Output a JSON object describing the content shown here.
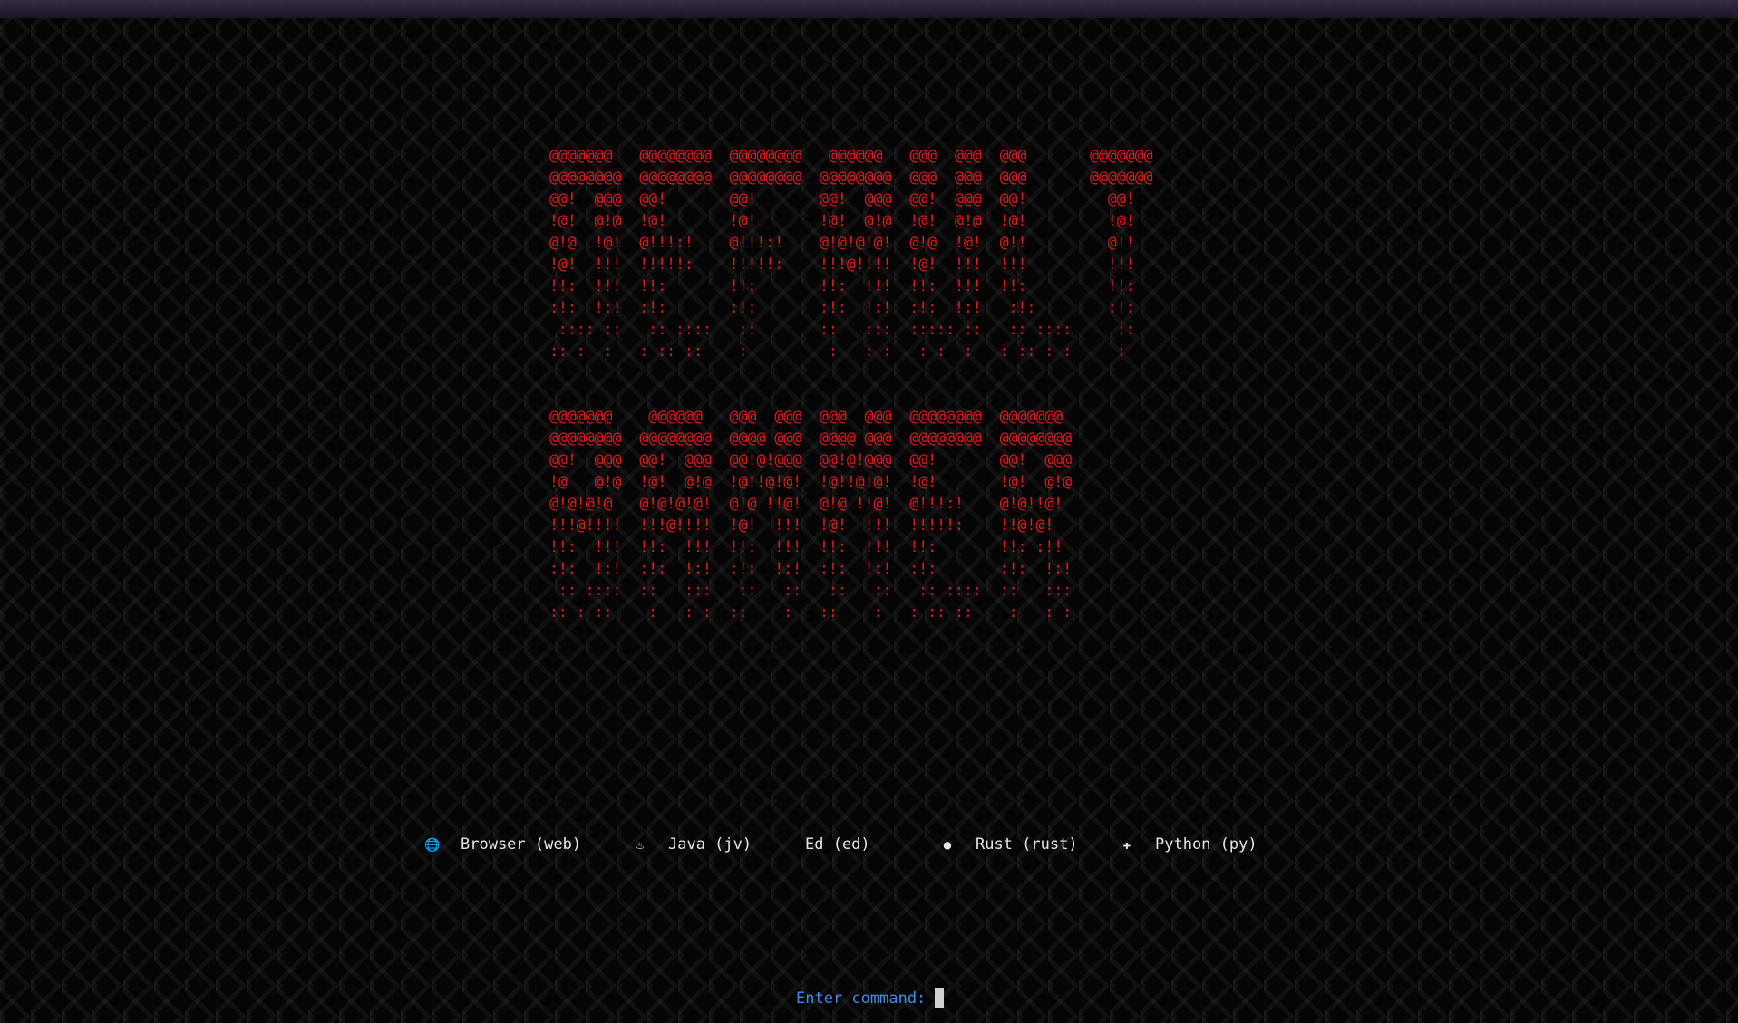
{
  "banner": {
    "lines_1": "@@@@@@@   @@@@@@@@  @@@@@@@@   @@@@@@   @@@  @@@  @@@       @@@@@@@\n@@@@@@@@  @@@@@@@@  @@@@@@@@  @@@@@@@@  @@@  @@@  @@@       @@@@@@@\n@@!  @@@  @@!       @@!       @@!  @@@  @@!  @@@  @@!         @@!\n!@!  @!@  !@!       !@!       !@!  @!@  !@!  @!@  !@!         !@!\n@!@  !@!  @!!!:!    @!!!:!    @!@!@!@!  @!@  !@!  @!!         @!!\n!@!  !!!  !!!!!:    !!!!!:    !!!@!!!!  !@!  !!!  !!!         !!!\n!!:  !!!  !!:       !!:       !!:  !!!  !!:  !!!  !!:         !!:\n:!:  !:!  :!:       :!:       :!:  !:!  :!:  !:!   :!:        :!:\n :::: ::   :: ::::   ::       ::   :::  ::::: ::   :: ::::     ::\n:: :  :   : :: ::    :         :   : :   : :  :   : :: : :     :",
    "lines_2": "@@@@@@@    @@@@@@   @@@  @@@  @@@  @@@  @@@@@@@@  @@@@@@@\n@@@@@@@@  @@@@@@@@  @@@@ @@@  @@@@ @@@  @@@@@@@@  @@@@@@@@\n@@!  @@@  @@!  @@@  @@!@!@@@  @@!@!@@@  @@!       @@!  @@@\n!@   @!@  !@!  @!@  !@!!@!@!  !@!!@!@!  !@!       !@!  @!@\n@!@!@!@   @!@!@!@!  @!@ !!@!  @!@ !!@!  @!!!:!    @!@!!@!\n!!!@!!!!  !!!@!!!!  !@!  !!!  !@!  !!!  !!!!!:    !!@!@!\n!!:  !!!  !!:  !!!  !!:  !!!  !!:  !!!  !!:       !!: :!!\n:!:  !:!  :!:  !:!  :!:  !:!  :!:  !:!  :!:       :!:  !:!\n :: ::::  ::   :::   ::   ::   ::   ::   :: ::::  ::   :::\n:: : ::    :   : :  ::    :   ::    :   : :: ::    :   : :"
  },
  "menu": {
    "items": [
      {
        "icon": "globe-icon",
        "glyph": "🌐",
        "label": "Browser (web)"
      },
      {
        "icon": "java-icon",
        "glyph": "♨",
        "label": "Java (jv)"
      },
      {
        "icon": "",
        "glyph": "",
        "label": "Ed   (ed)"
      },
      {
        "icon": "rust-icon",
        "glyph": "●",
        "label": "Rust (rust)"
      },
      {
        "icon": "python-icon",
        "glyph": "✚",
        "label": "Python (py)"
      }
    ]
  },
  "prompt": {
    "label": "Enter command:"
  },
  "colors": {
    "banner": "#e01a1a",
    "prompt": "#3f8be6",
    "menu_text": "#e6e6e6",
    "background": "#050506"
  }
}
